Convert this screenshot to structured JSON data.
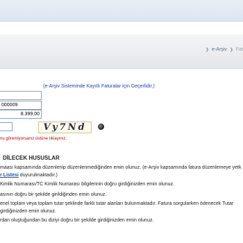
{
  "breadcrumb": {
    "items": [
      "e-Arşiv",
      "Fat"
    ]
  },
  "form": {
    "field1_value": "3",
    "field2_value": "000009",
    "amount_value": "8.399,00",
    "note": "(e-Arşiv Sisteminde Kayıtlı Faturalar İçin Geçerlidir.)",
    "captcha_input_value": "",
    "captcha_text": "Vy7Nd",
    "captcha_hint": "nu göremiyorsanız üstüne tıklayınız."
  },
  "section": {
    "title": "DİLECEK HUSUSLAR",
    "line1": "maası kapsamında düzenlenip düzenlenmediğinden emin olunuz. (e-Arşiv kapsamında fatura düzenlemeye yetk",
    "line2_link": "r Listesi",
    "line2_rest": " duyurulmaktadır.)",
    "line3": " Kimlik Numarası/TC Kimlik Numarası bilgilerinin doğru girdiğinizden emin olunuz.",
    "line4": "asının doğru bir şekilde girildiğinden emin olunuz.",
    "line5": "enel toplam veya toplam tutar şeklinde farklı tutar alanları bulunmaktadır. Fatura sorgularken ödenecek Tutar",
    "line6": "girdiğinizden emin olunuz.",
    "line7": "rdan oluştuğundan bu diziyi doğru bir şekilde girdiğinizden emin olunuz."
  }
}
